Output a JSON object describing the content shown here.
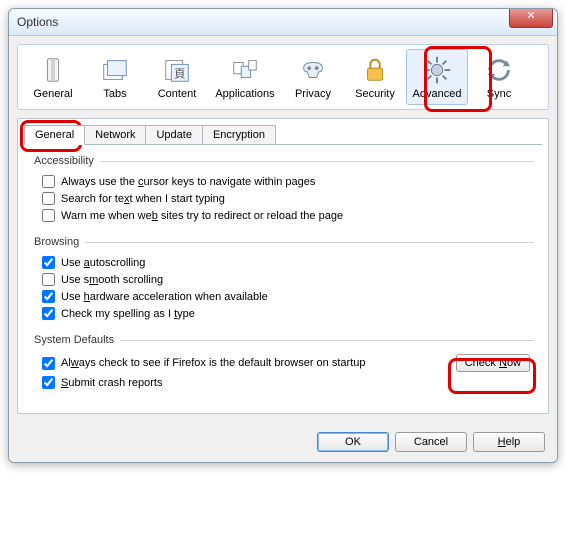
{
  "window": {
    "title": "Options"
  },
  "categories": [
    {
      "id": "general",
      "label": "General"
    },
    {
      "id": "tabs",
      "label": "Tabs"
    },
    {
      "id": "content",
      "label": "Content"
    },
    {
      "id": "applications",
      "label": "Applications"
    },
    {
      "id": "privacy",
      "label": "Privacy"
    },
    {
      "id": "security",
      "label": "Security"
    },
    {
      "id": "advanced",
      "label": "Advanced",
      "selected": true
    },
    {
      "id": "sync",
      "label": "Sync"
    }
  ],
  "subtabs": [
    {
      "id": "general",
      "label": "General",
      "active": true
    },
    {
      "id": "network",
      "label": "Network"
    },
    {
      "id": "update",
      "label": "Update"
    },
    {
      "id": "encryption",
      "label": "Encryption"
    }
  ],
  "groups": {
    "accessibility": {
      "legend": "Accessibility",
      "items": [
        {
          "label": "Always use the cursor keys to navigate within pages",
          "checked": false,
          "accel": "c"
        },
        {
          "label": "Search for text when I start typing",
          "checked": false,
          "accel": "x"
        },
        {
          "label": "Warn me when web sites try to redirect or reload the page",
          "checked": false,
          "accel": "b"
        }
      ]
    },
    "browsing": {
      "legend": "Browsing",
      "items": [
        {
          "label": "Use autoscrolling",
          "checked": true,
          "accel": "a"
        },
        {
          "label": "Use smooth scrolling",
          "checked": false,
          "accel": "m"
        },
        {
          "label": "Use hardware acceleration when available",
          "checked": true,
          "accel": "h"
        },
        {
          "label": "Check my spelling as I type",
          "checked": true,
          "accel": "t"
        }
      ]
    },
    "system": {
      "legend": "System Defaults",
      "defaultBrowser": {
        "label": "Always check to see if Firefox is the default browser on startup",
        "checked": true,
        "accel": "w"
      },
      "checkNow": "Check Now",
      "crashReports": {
        "label": "Submit crash reports",
        "checked": true,
        "accel": "S"
      }
    }
  },
  "buttons": {
    "ok": "OK",
    "cancel": "Cancel",
    "help": "Help"
  }
}
